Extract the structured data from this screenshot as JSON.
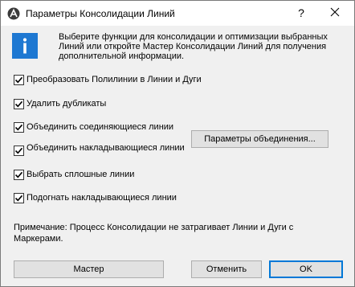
{
  "window": {
    "title": "Параметры Консолидации Линий",
    "help_label": "?"
  },
  "icons": {
    "app": "archicad-logo-icon",
    "info": "info-icon",
    "close": "close-icon",
    "check": "checkmark-icon"
  },
  "colors": {
    "info_icon_bg": "#1e78d2",
    "default_button_border": "#0078d7"
  },
  "intro": {
    "text": "Выберите функции для консолидации и оптимизации выбранных Линий или откройте Мастер Консолидации Линий для получения дополнительной информации."
  },
  "options": [
    {
      "label": "Преобразовать Полилинии в Линии и Дуги",
      "checked": true
    },
    {
      "label": "Удалить дубликаты",
      "checked": true
    },
    {
      "label": "Объединить соединяющиеся линии",
      "checked": true
    },
    {
      "label": "Объединить накладывающиеся линии",
      "checked": true
    },
    {
      "label": "Выбрать сплошные линии",
      "checked": true
    },
    {
      "label": "Подогнать накладывающиеся линии",
      "checked": true
    }
  ],
  "merge_params_button": "Параметры объединения...",
  "note": "Примечание: Процесс Консолидации не затрагивает Линии и Дуги с Маркерами.",
  "buttons": {
    "wizard": "Мастер",
    "cancel": "Отменить",
    "ok": "OK"
  }
}
